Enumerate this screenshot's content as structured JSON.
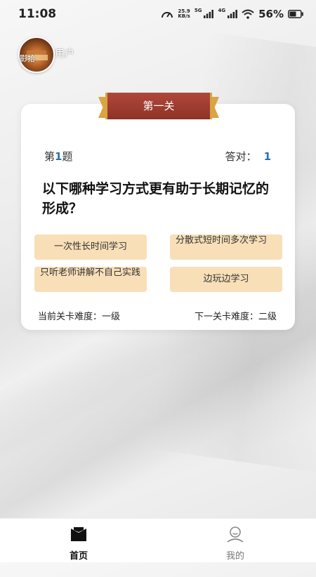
{
  "status_bar": {
    "time": "11:08",
    "net_speed_value": "25.9",
    "net_speed_unit": "KB/s",
    "signal_tag_1": "5G",
    "signal_tag_2": "4G",
    "battery": "56%"
  },
  "profile": {
    "username": "用户",
    "avatar_caption": "影拾"
  },
  "level": {
    "banner_title": "第一关"
  },
  "quiz": {
    "question_prefix": "第",
    "question_number": "1",
    "question_suffix": "题",
    "correct_label": "答对：",
    "correct_count": "1",
    "question_text": "以下哪种学习方式更有助于长期记忆的形成？",
    "options": [
      "一次性长时间学习",
      "分散式短时间多次学习",
      "只听老师讲解不自己实践",
      "边玩边学习"
    ],
    "current_difficulty": "当前关卡难度：一级",
    "next_difficulty": "下一关卡难度：二级"
  },
  "tabbar": {
    "home_label": "首页",
    "mine_label": "我的"
  },
  "icons": {
    "speedometer": "speedometer-icon",
    "signal": "signal-icon",
    "wifi": "wifi-icon",
    "battery": "battery-icon",
    "home": "home-icon",
    "user": "user-icon"
  },
  "colors": {
    "banner_red": "#9c3a2e",
    "banner_gold": "#d9a441",
    "option_bg": "#f8dfb7",
    "highlight_blue": "#2a6fb0"
  }
}
